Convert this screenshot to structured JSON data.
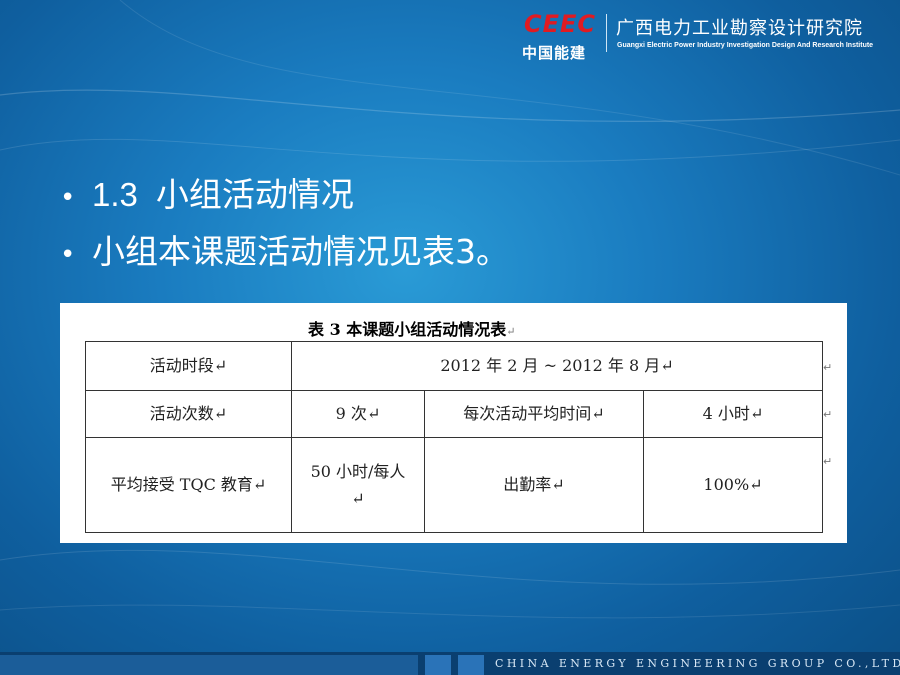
{
  "header": {
    "logo_text": "CEEC",
    "logo_cn": "中国能建",
    "institute_cn": "广西电力工业勘察设计研究院",
    "institute_en": "Guangxi Electric Power Industry Investigation Design And Research Institute"
  },
  "bullets": [
    {
      "number": "1.3",
      "text": "小组活动情况"
    },
    {
      "text": "小组本课题活动情况见表3。"
    }
  ],
  "table": {
    "title": "表 3   本课题小组活动情况表",
    "rows": [
      [
        "活动时段",
        "2012 年 2 月 ~ 2012 年 8 月"
      ],
      [
        "活动次数",
        "9 次",
        "每次活动平均时间",
        "4 小时"
      ],
      [
        "平均接受 TQC 教育",
        "50 小时/每人",
        "出勤率",
        "100%"
      ]
    ]
  },
  "footer": {
    "company": "CHINA ENERGY ENGINEERING GROUP CO.,LTD."
  }
}
